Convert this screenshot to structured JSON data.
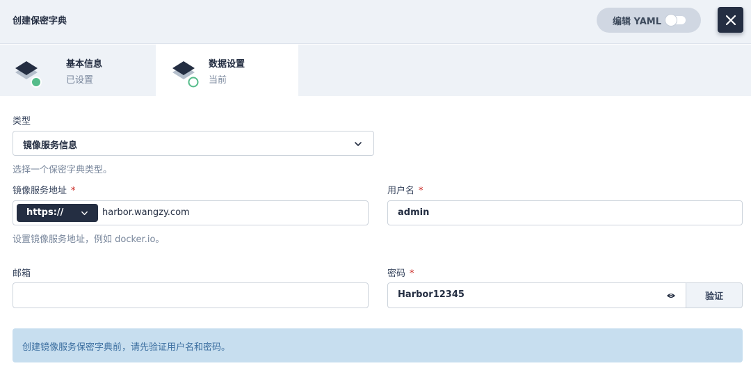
{
  "header": {
    "title": "创建保密字典",
    "yaml_label": "编辑 YAML",
    "yaml_enabled": false
  },
  "steps": [
    {
      "title": "基本信息",
      "status": "已设置"
    },
    {
      "title": "数据设置",
      "status": "当前"
    }
  ],
  "form": {
    "type_label": "类型",
    "type_value": "镜像服务信息",
    "type_help": "选择一个保密字典类型。",
    "registry_label": "镜像服务地址",
    "registry_protocol": "https://",
    "registry_value": "harbor.wangzy.com",
    "registry_help": "设置镜像服务地址，例如 docker.io。",
    "username_label": "用户名",
    "username_value": "admin",
    "email_label": "邮箱",
    "email_value": "",
    "password_label": "密码",
    "password_value": "Harbor12345",
    "verify_label": "验证",
    "required_mark": "*"
  },
  "notice": {
    "text": "创建镜像服务保密字典前，请先验证用户名和密码。"
  },
  "colors": {
    "dark": "#242e42",
    "done": "#55bc8a",
    "required": "#ca2621",
    "notice_bg": "#c7deef"
  }
}
